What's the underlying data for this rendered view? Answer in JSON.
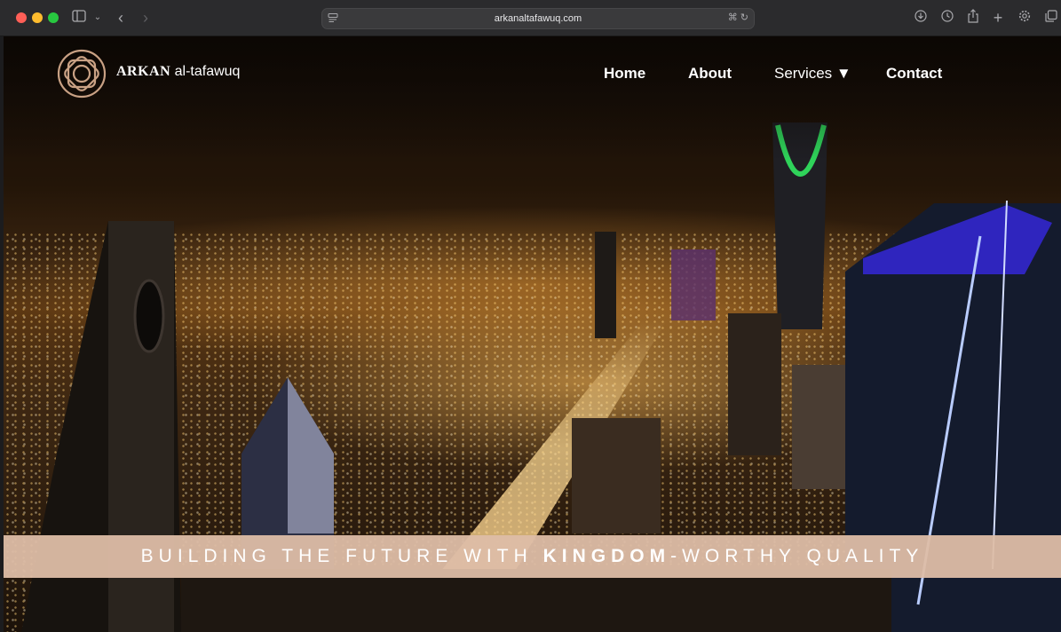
{
  "browser": {
    "url": "arkanaltafawuq.com",
    "icons": [
      "sidebar-icon",
      "chevron-down-icon",
      "back-icon",
      "forward-icon",
      "translate-icon",
      "reload-icon",
      "downloads-icon",
      "history-icon",
      "share-icon",
      "new-tab-icon",
      "settings-icon",
      "tabs-overview-icon"
    ]
  },
  "header": {
    "brand_bold": "ARKAN",
    "brand_rest": " al-tafawuq",
    "nav": {
      "home": "Home",
      "about": "About",
      "services": "Services ▼",
      "contact": "Contact"
    }
  },
  "banner": {
    "part1": "BUILDING THE FUTURE WITH ",
    "highlight": "KINGDOM",
    "part2": "-WORTHY QUALITY"
  },
  "colors": {
    "banner_bg": "#DDBDA7",
    "logo": "#C9A184",
    "toolbar": "#2B2B2D"
  }
}
